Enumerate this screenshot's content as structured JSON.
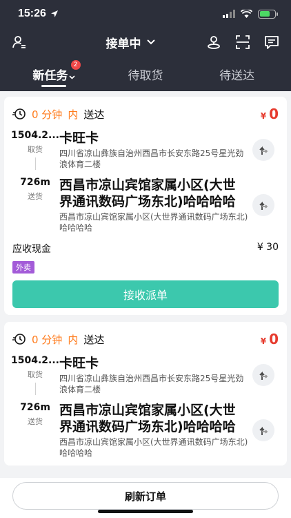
{
  "status_bar": {
    "time": "15:26"
  },
  "header": {
    "title": "接单中"
  },
  "tabs": [
    {
      "label": "新任务",
      "badge": "2"
    },
    {
      "label": "待取货"
    },
    {
      "label": "待送达"
    }
  ],
  "orders": [
    {
      "eta_value": "0 分钟",
      "eta_within": "内",
      "eta_action": "送达",
      "price_symbol": "¥",
      "price_value": "0",
      "pickup": {
        "distance": "1504.2...",
        "label": "取货",
        "name": "卡旺卡",
        "address": "四川省凉山彝族自治州西昌市长安东路25号星光劲浪体育二楼"
      },
      "dropoff": {
        "distance": "726m",
        "label": "送货",
        "name": "西昌市凉山宾馆家属小区(大世界通讯数码广场东北)哈哈哈哈",
        "address": "西昌市凉山宾馆家属小区(大世界通讯数码广场东北)哈哈哈哈"
      },
      "cash_label": "应收现金",
      "cash_value": "¥ 30",
      "tag": "外卖",
      "accept_label": "接收派单"
    },
    {
      "eta_value": "0 分钟",
      "eta_within": "内",
      "eta_action": "送达",
      "price_symbol": "¥",
      "price_value": "0",
      "pickup": {
        "distance": "1504.2...",
        "label": "取货",
        "name": "卡旺卡",
        "address": "四川省凉山彝族自治州西昌市长安东路25号星光劲浪体育二楼"
      },
      "dropoff": {
        "distance": "726m",
        "label": "送货",
        "name": "西昌市凉山宾馆家属小区(大世界通讯数码广场东北)哈哈哈哈",
        "address": "西昌市凉山宾馆家属小区(大世界通讯数码广场东北)哈哈哈哈"
      }
    }
  ],
  "bottom": {
    "refresh_label": "刷新订单"
  },
  "colors": {
    "header_bg": "#2c2f3a",
    "accent": "#3cc8ad",
    "price": "#e63b2e",
    "eta": "#ff7a1a",
    "tag": "#a35bd8"
  }
}
